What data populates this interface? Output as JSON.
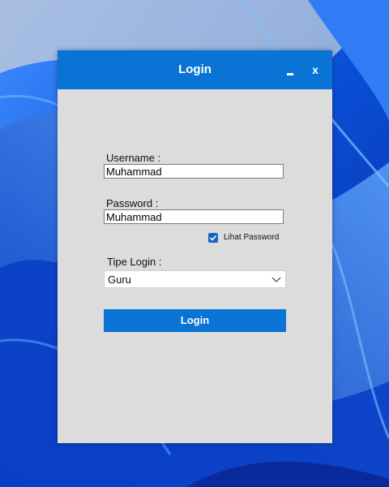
{
  "window": {
    "title": "Login",
    "minimize_label": "_",
    "close_label": "x"
  },
  "form": {
    "username_label": "Username :",
    "username_value": "Muhammad",
    "password_label": "Password :",
    "password_value": "Muhammad",
    "show_password_label": "Lihat Password",
    "show_password_checked": true,
    "login_type_label": "Tipe Login :",
    "login_type_value": "Guru",
    "login_button_label": "Login"
  },
  "colors": {
    "accent": "#0a74d6",
    "window_bg": "#dcdcdc",
    "checkbox": "#1565c0"
  },
  "icons": {
    "checkbox": "checkmark-icon",
    "dropdown": "chevron-down-icon"
  }
}
